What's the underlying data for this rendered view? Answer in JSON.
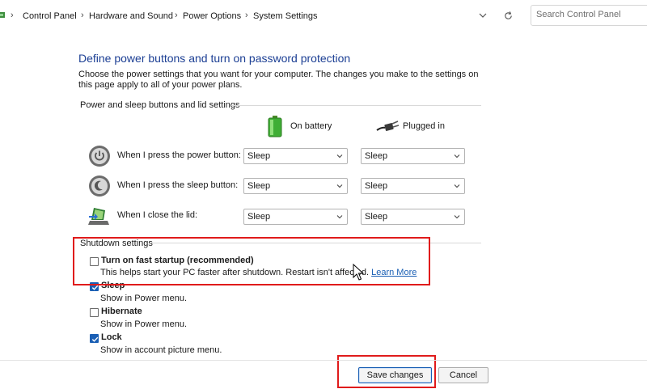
{
  "address_bar": {
    "breadcrumbs": [
      "Control Panel",
      "Hardware and Sound",
      "Power Options",
      "System Settings"
    ],
    "search_placeholder": "Search Control Panel"
  },
  "page": {
    "title": "Define power buttons and turn on password protection",
    "description": "Choose the power settings that you want for your computer. The changes you make to the settings on this page apply to all of your power plans."
  },
  "power_section": {
    "label": "Power and sleep buttons and lid settings",
    "columns": [
      "On battery",
      "Plugged in"
    ],
    "rows": [
      {
        "label": "When I press the power button:",
        "icon": "power-button-icon",
        "on_battery": "Sleep",
        "plugged_in": "Sleep"
      },
      {
        "label": "When I press the sleep button:",
        "icon": "sleep-button-icon",
        "on_battery": "Sleep",
        "plugged_in": "Sleep"
      },
      {
        "label": "When I close the lid:",
        "icon": "laptop-lid-icon",
        "on_battery": "Sleep",
        "plugged_in": "Sleep"
      }
    ]
  },
  "shutdown_section": {
    "label": "Shutdown settings",
    "options": [
      {
        "title": "Turn on fast startup (recommended)",
        "desc": "This helps start your PC faster after shutdown. Restart isn't affected.",
        "link": "Learn More",
        "checked": false
      },
      {
        "title": "Sleep",
        "desc": "Show in Power menu.",
        "checked": true
      },
      {
        "title": "Hibernate",
        "desc": "Show in Power menu.",
        "checked": false
      },
      {
        "title": "Lock",
        "desc": "Show in account picture menu.",
        "checked": true
      }
    ]
  },
  "footer": {
    "save_label": "Save changes",
    "cancel_label": "Cancel"
  },
  "colors": {
    "title": "#1c3f94",
    "link": "#1a5fb4",
    "highlight_box": "#e01b1b"
  }
}
